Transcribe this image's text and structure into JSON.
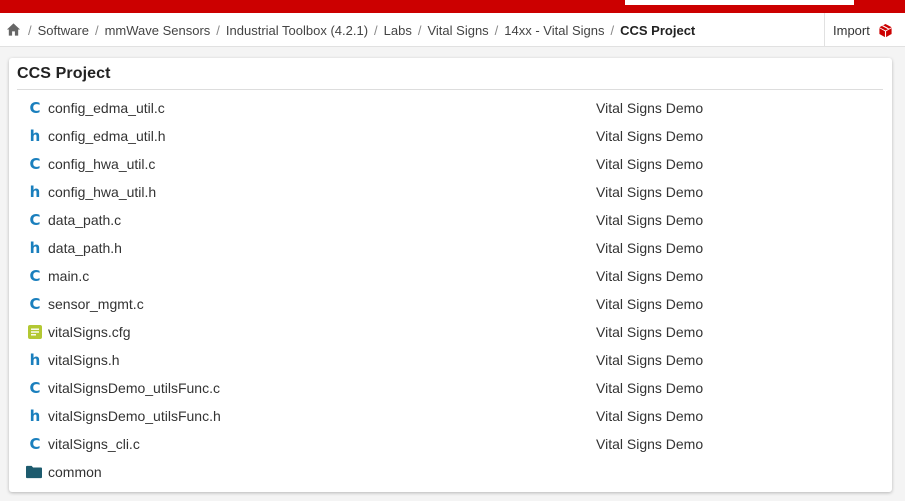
{
  "colors": {
    "brand_red": "#cc0000",
    "icon_blue": "#1a7fbd",
    "icon_green": "#b3c833",
    "folder_dark": "#1d5b6e"
  },
  "breadcrumb": {
    "home_icon": "home-icon",
    "items": [
      {
        "label": "Software"
      },
      {
        "label": "mmWave Sensors"
      },
      {
        "label": "Industrial Toolbox (4.2.1)"
      },
      {
        "label": "Labs"
      },
      {
        "label": "Vital Signs"
      },
      {
        "label": "14xx - Vital Signs"
      }
    ],
    "current": "CCS Project",
    "separator": "/"
  },
  "toolbar": {
    "import_label": "Import",
    "import_icon": "package-icon"
  },
  "panel": {
    "title": "CCS Project"
  },
  "files": [
    {
      "type": "c",
      "icon": "C",
      "name": "config_edma_util.c",
      "desc": "Vital Signs Demo"
    },
    {
      "type": "h",
      "icon": "h",
      "name": "config_edma_util.h",
      "desc": "Vital Signs Demo"
    },
    {
      "type": "c",
      "icon": "C",
      "name": "config_hwa_util.c",
      "desc": "Vital Signs Demo"
    },
    {
      "type": "h",
      "icon": "h",
      "name": "config_hwa_util.h",
      "desc": "Vital Signs Demo"
    },
    {
      "type": "c",
      "icon": "C",
      "name": "data_path.c",
      "desc": "Vital Signs Demo"
    },
    {
      "type": "h",
      "icon": "h",
      "name": "data_path.h",
      "desc": "Vital Signs Demo"
    },
    {
      "type": "c",
      "icon": "C",
      "name": "main.c",
      "desc": "Vital Signs Demo"
    },
    {
      "type": "c",
      "icon": "C",
      "name": "sensor_mgmt.c",
      "desc": "Vital Signs Demo"
    },
    {
      "type": "cfg",
      "icon": "",
      "name": "vitalSigns.cfg",
      "desc": "Vital Signs Demo"
    },
    {
      "type": "h",
      "icon": "h",
      "name": "vitalSigns.h",
      "desc": "Vital Signs Demo"
    },
    {
      "type": "c",
      "icon": "C",
      "name": "vitalSignsDemo_utilsFunc.c",
      "desc": "Vital Signs Demo"
    },
    {
      "type": "h",
      "icon": "h",
      "name": "vitalSignsDemo_utilsFunc.h",
      "desc": "Vital Signs Demo"
    },
    {
      "type": "c",
      "icon": "C",
      "name": "vitalSigns_cli.c",
      "desc": "Vital Signs Demo"
    },
    {
      "type": "folder",
      "icon": "",
      "name": "common",
      "desc": ""
    }
  ]
}
